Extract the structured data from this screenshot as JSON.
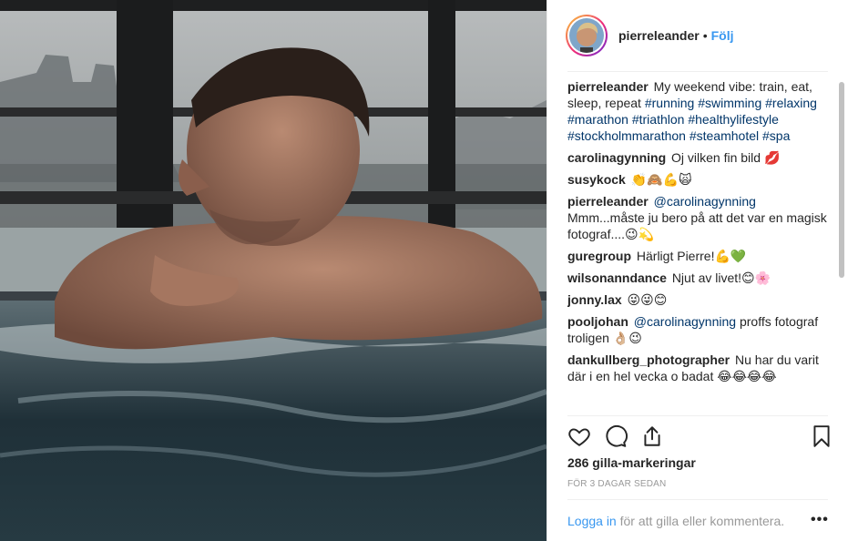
{
  "author": {
    "username": "pierreleander",
    "dot": "•",
    "follow_label": "Följ"
  },
  "caption": {
    "username": "pierreleander",
    "text": "My weekend vibe: train, eat, sleep, repeat",
    "hashtags": [
      "#running",
      "#swimming",
      "#relaxing",
      "#marathon",
      "#triathlon",
      "#healthylifestyle",
      "#stockholmmarathon",
      "#steamhotel",
      "#spa"
    ]
  },
  "comments": [
    {
      "username": "carolinagynning",
      "text": "Oj vilken fin bild 💋"
    },
    {
      "username": "susykock",
      "text": "👏🙈💪🙀"
    },
    {
      "username": "pierreleander",
      "mention": "@carolinagynning",
      "text": "Mmm...måste ju bero på att det var en magisk fotograf....😉💫"
    },
    {
      "username": "guregroup",
      "text": "Härligt Pierre!💪💚"
    },
    {
      "username": "wilsonanndance",
      "text": "Njut av livet!😊🌸"
    },
    {
      "username": "jonny.lax",
      "text": "😜😜😊"
    },
    {
      "username": "pooljohan",
      "mention": "@carolinagynning",
      "text": "proffs fotograf troligen 👌🏼😉"
    },
    {
      "username": "dankullberg_photographer",
      "text": "Nu har du varit där i en hel vecka o badat 😂😂😂😂"
    }
  ],
  "actions": {
    "like_icon": "heart-icon",
    "comment_icon": "comment-icon",
    "share_icon": "share-icon",
    "save_icon": "bookmark-icon"
  },
  "likes_text": "286 gilla-markeringar",
  "timestamp": "FÖR 3 DAGAR SEDAN",
  "login": {
    "link": "Logga in",
    "text": "för att gilla eller kommentera."
  },
  "more_label": "•••",
  "colors": {
    "link_blue": "#3897f0",
    "hashtag_blue": "#003569",
    "muted": "#999999"
  }
}
